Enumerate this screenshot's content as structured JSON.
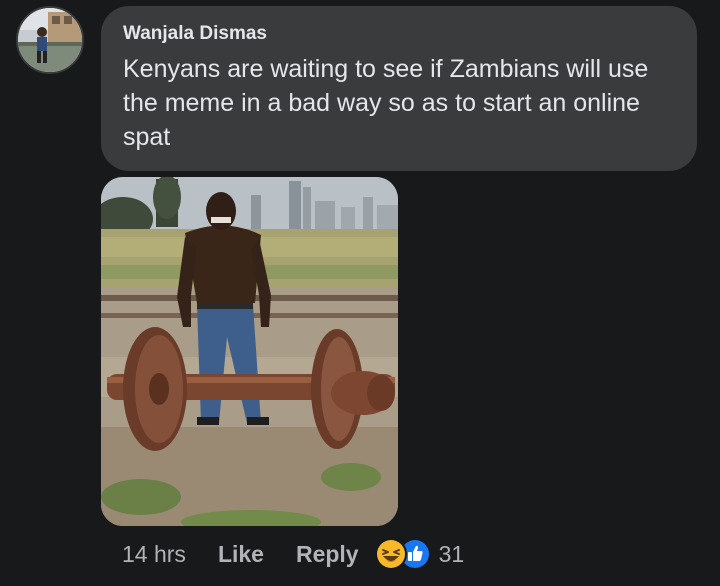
{
  "comment": {
    "author": "Wanjala Dismas",
    "text": "Kenyans are waiting to see if Zambians will use the meme in a bad way so as to start an online spat",
    "time": "14 hrs",
    "actions": {
      "like_label": "Like",
      "reply_label": "Reply"
    },
    "reactions": {
      "icons": [
        "haha-icon",
        "like-icon"
      ],
      "count": "31"
    },
    "colors": {
      "background": "#18191a",
      "bubble": "#3a3b3c",
      "text": "#e4e6eb",
      "secondary_text": "#b0b3b8",
      "like_blue": "#1877f2",
      "haha_yellow": "#f7b928"
    }
  }
}
